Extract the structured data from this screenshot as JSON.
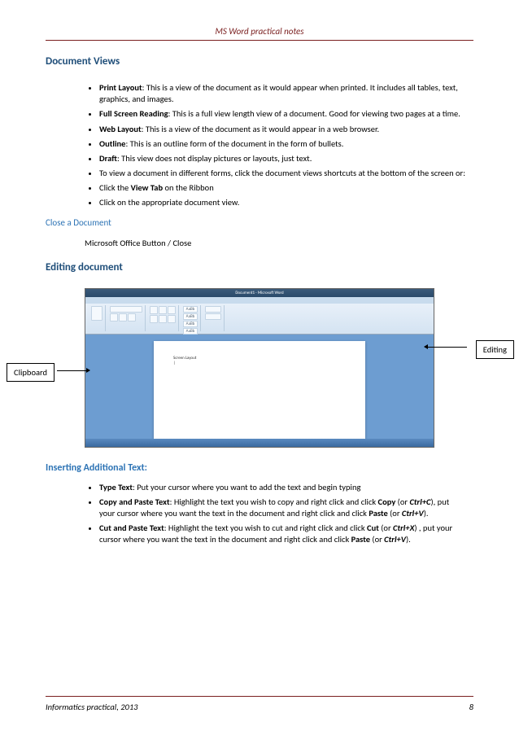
{
  "header": {
    "title": "MS Word practical notes"
  },
  "sections": {
    "documentViews": {
      "title": "Document Views",
      "items": [
        {
          "bold": "Print Layout",
          "rest": ":  This is a view of the document as it would appear when printed.  It includes all tables, text, graphics, and images."
        },
        {
          "bold": "Full Screen Reading",
          "rest": ":  This is a full view length view of a document.  Good for viewing two pages at a time."
        },
        {
          "bold": "Web Layout",
          "rest": ":  This is a view of the document as it would appear in a web browser."
        },
        {
          "bold": "Outline",
          "rest": ":  This is an outline form of the document in the form of bullets."
        },
        {
          "bold": "Draft",
          "rest": ":  This view does not display pictures or layouts, just text."
        },
        {
          "plain": "To view a document in different forms, click the document views shortcuts at the bottom of the screen or:"
        },
        {
          "pre": "Click the ",
          "bold": "View Tab",
          "rest": " on the Ribbon"
        },
        {
          "plain": "Click on the appropriate document view."
        }
      ]
    },
    "closeDoc": {
      "title": "Close a Document",
      "text": "Microsoft Office Button / Close"
    },
    "editing": {
      "title": "Editing document"
    },
    "callouts": {
      "left": "Clipboard",
      "right": "Editing"
    },
    "screenshot": {
      "titlebar": "Document1 - Microsoft Word",
      "docText1": "Screen Layout",
      "docText2": "|",
      "styleLabel": "AaBb"
    },
    "inserting": {
      "title": "Inserting Additional Text:",
      "items": [
        {
          "bold": "Type Text",
          "rest": ":  Put your cursor where you want to add the text and begin typing"
        },
        {
          "bold": "Copy and Paste Text",
          "rest": ":  Highlight the text you wish to copy and right click and click ",
          "bold2": "Copy",
          "rest2": " (or ",
          "bold3": "Ctrl+C",
          "rest3": "), put your cursor where you want the text in the document and right click and click ",
          "bold4": "Paste",
          "rest4": " (or ",
          "bold5": "Ctrl+V",
          "rest5": ")."
        },
        {
          "bold": "Cut and Paste Text",
          "rest": ":  Highlight the text you wish to cut and right click and click ",
          "bold2": "Cut",
          "rest2": " (or ",
          "bold3": "Ctrl+X",
          "rest3": ") , put your cursor where you want the text in the document and right click and click ",
          "bold4": "Paste",
          "rest4": " (or ",
          "bold5": "Ctrl+V",
          "rest5": ")."
        }
      ]
    }
  },
  "footer": {
    "left": "Informatics practical, 2013",
    "right": "8"
  }
}
